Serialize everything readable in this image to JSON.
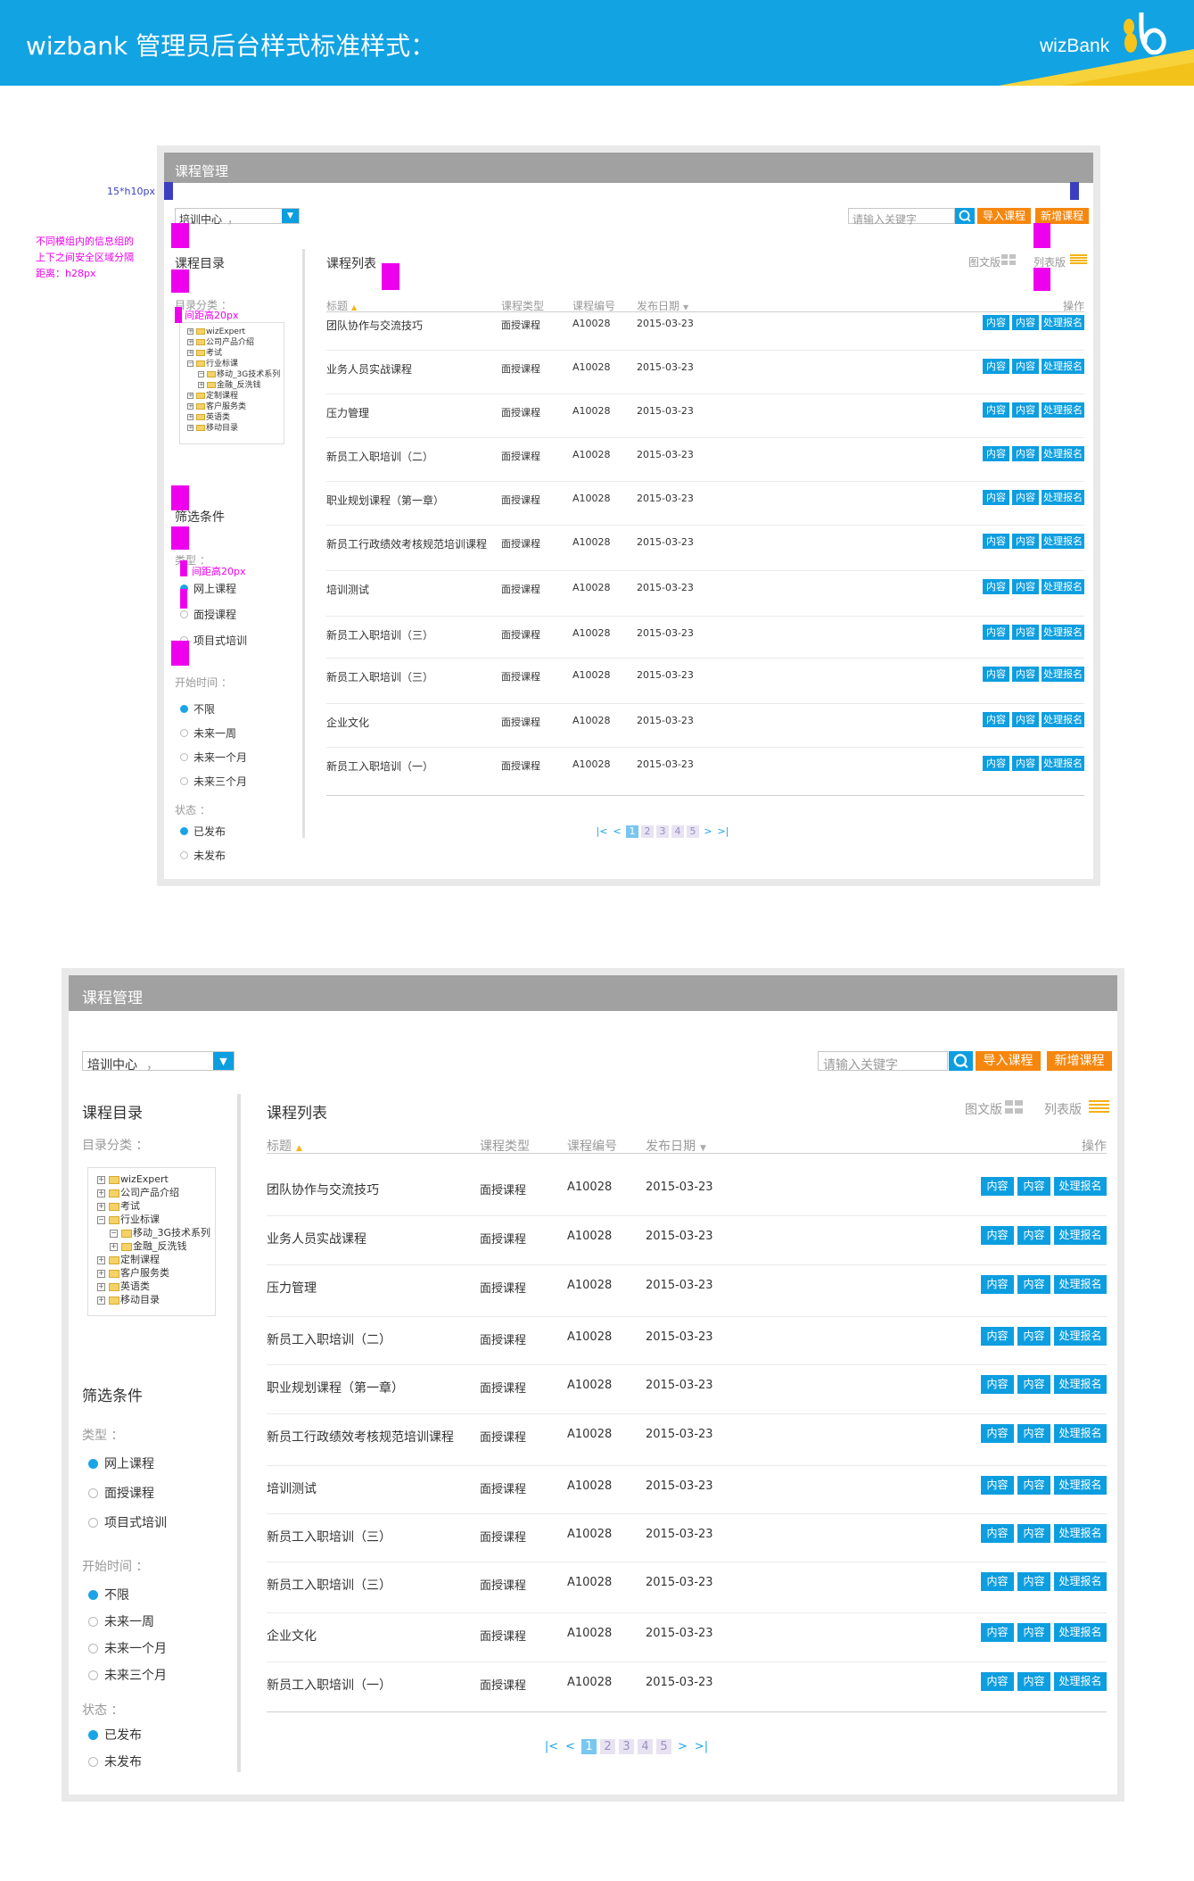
{
  "banner": {
    "title": "wizbank 管理员后台样式标准样式：",
    "logo_text": "wizBank",
    "bg_color": "#12a3e3"
  },
  "annotations": {
    "bar_size": "15*h10px",
    "safe_area_note": [
      "不同模组内的信息组的",
      "上下之间安全区域分隔",
      "距离：h28px"
    ],
    "gap20_a": "间距高20px",
    "gap20_b": "间距高20px"
  },
  "panel": {
    "header_title": "课程管理",
    "org_select": {
      "value": "培训中心",
      "suffix": "，"
    },
    "search": {
      "placeholder": "请输入关键字",
      "icon": "search-icon"
    },
    "buttons": {
      "import": "导入课程",
      "add": "新增课程"
    },
    "sidebar": {
      "catalog_title": "课程目录",
      "catalog_label": "目录分类 ：",
      "tree": [
        {
          "label": "wizExpert",
          "level": 0,
          "sign": "+"
        },
        {
          "label": "公司产品介绍",
          "level": 0,
          "sign": "+"
        },
        {
          "label": "考试",
          "level": 0,
          "sign": "+"
        },
        {
          "label": "行业标课",
          "level": 0,
          "sign": "−"
        },
        {
          "label": "移动_3G技术系列",
          "level": 1,
          "sign": "−"
        },
        {
          "label": "金融_反洗钱",
          "level": 1,
          "sign": "+"
        },
        {
          "label": "定制课程",
          "level": 0,
          "sign": "+"
        },
        {
          "label": "客户服务类",
          "level": 0,
          "sign": "+"
        },
        {
          "label": "英语类",
          "level": 0,
          "sign": "+"
        },
        {
          "label": "移动目录",
          "level": 0,
          "sign": "+"
        }
      ],
      "filter_title": "筛选条件",
      "type_label": "类型 ：",
      "type_options": [
        {
          "label": "网上课程",
          "checked": true
        },
        {
          "label": "面授课程",
          "checked": false
        },
        {
          "label": "项目式培训",
          "checked": false
        }
      ],
      "time_label": "开始时间 ：",
      "time_options": [
        {
          "label": "不限",
          "checked": true
        },
        {
          "label": "未来一周",
          "checked": false
        },
        {
          "label": "未来一个月",
          "checked": false
        },
        {
          "label": "未来三个月",
          "checked": false
        }
      ],
      "status_label": "状态 ：",
      "status_options": [
        {
          "label": "已发布",
          "checked": true
        },
        {
          "label": "未发布",
          "checked": false
        }
      ]
    },
    "list": {
      "title": "课程列表",
      "view_graphic": "图文版",
      "view_list": "列表版",
      "columns": [
        "标题",
        "课程类型",
        "课程编号",
        "发布日期",
        "操作"
      ],
      "rows": [
        {
          "title": "团队协作与交流技巧",
          "type": "面授课程",
          "code": "A10028",
          "date": "2015-03-23"
        },
        {
          "title": "业务人员实战课程",
          "type": "面授课程",
          "code": "A10028",
          "date": "2015-03-23"
        },
        {
          "title": "压力管理",
          "type": "面授课程",
          "code": "A10028",
          "date": "2015-03-23"
        },
        {
          "title": "新员工入职培训（二）",
          "type": "面授课程",
          "code": "A10028",
          "date": "2015-03-23"
        },
        {
          "title": "职业规划课程（第一章）",
          "type": "面授课程",
          "code": "A10028",
          "date": "2015-03-23"
        },
        {
          "title": "新员工行政绩效考核规范培训课程",
          "type": "面授课程",
          "code": "A10028",
          "date": "2015-03-23"
        },
        {
          "title": "培训测试",
          "type": "面授课程",
          "code": "A10028",
          "date": "2015-03-23"
        },
        {
          "title": "新员工入职培训（三）",
          "type": "面授课程",
          "code": "A10028",
          "date": "2015-03-23"
        },
        {
          "title": "新员工入职培训（三）",
          "type": "面授课程",
          "code": "A10028",
          "date": "2015-03-23"
        },
        {
          "title": "企业文化",
          "type": "面授课程",
          "code": "A10028",
          "date": "2015-03-23"
        },
        {
          "title": "新员工入职培训（一）",
          "type": "面授课程",
          "code": "A10028",
          "date": "2015-03-23"
        }
      ],
      "row_actions": [
        "内容",
        "内容",
        "处理报名"
      ]
    },
    "pager": {
      "first": "|<",
      "prev": "<",
      "pages": [
        "1",
        "2",
        "3",
        "4",
        "5"
      ],
      "current": "1",
      "next": ">",
      "last": ">|"
    }
  }
}
